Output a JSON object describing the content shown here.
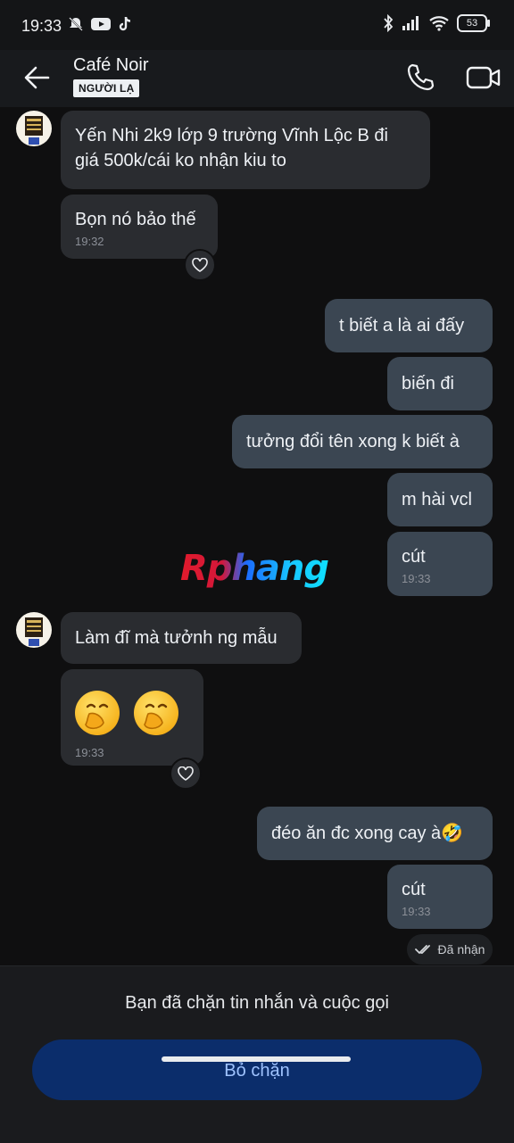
{
  "status_bar": {
    "time": "19:33",
    "battery": "53"
  },
  "header": {
    "name": "Café Noir",
    "badge": "NGƯỜI LẠ"
  },
  "messages": {
    "m1": "Yến Nhi 2k9 lớp 9 trường Vĩnh Lộc B đi giá 500k/cái ko nhận kiu to",
    "m2": "Bọn nó bảo thế",
    "m2_time": "19:32",
    "o1": "t biết a là ai đấy",
    "o2": "biến đi",
    "o3": "tưởng đổi tên xong k biết à",
    "o4": "m hài vcl",
    "o5": "cút",
    "o5_time": "19:33",
    "m3": "Làm đĩ mà tưởnh ng mẫu",
    "m4_time": "19:33",
    "o6": "đéo ăn đc xong cay à🤣",
    "o7": "cút",
    "o7_time": "19:33"
  },
  "watermark": "Rphang",
  "delivered": "Đã nhận",
  "blocked": {
    "text": "Bạn đã chặn tin nhắn và cuộc gọi",
    "button": "Bỏ chặn"
  },
  "icons": {
    "back": "back-arrow-icon",
    "call": "phone-icon",
    "video": "video-camera-icon",
    "heart": "heart-icon",
    "check": "double-check-icon"
  },
  "colors": {
    "background": "#0f0f10",
    "incoming_bubble": "#2a2c30",
    "outgoing_bubble": "#3b4652",
    "unblock_button": "#0b2d6b",
    "unblock_text": "#9fc3ff"
  }
}
